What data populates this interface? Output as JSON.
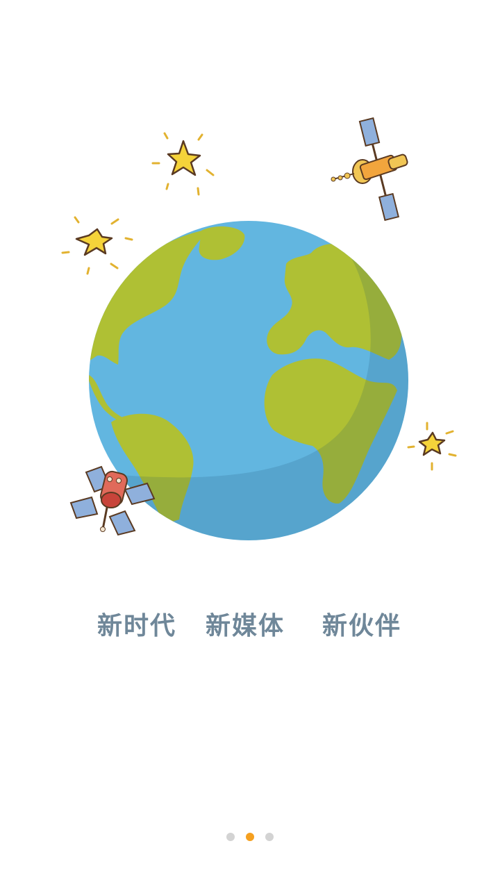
{
  "slogans": [
    "新时代",
    "新媒体",
    "新伙伴"
  ],
  "pager": {
    "count": 3,
    "active_index": 1
  },
  "colors": {
    "text": "#6f8799",
    "ocean": "#62b6e0",
    "land": "#afc034",
    "dot_active": "#f5a020",
    "dot_inactive": "#d3d3d3",
    "star": "#f5d33a"
  },
  "icons": [
    "globe-icon",
    "satellite-icon",
    "star-icon"
  ]
}
